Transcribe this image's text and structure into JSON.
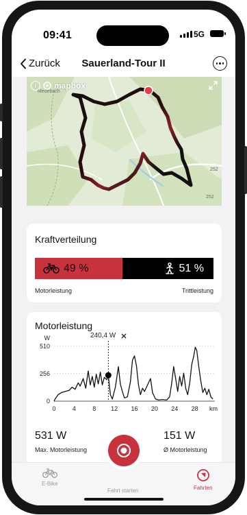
{
  "status": {
    "time": "09:41",
    "network": "5G"
  },
  "nav": {
    "back_label": "Zurück",
    "title": "Sauerland-Tour II"
  },
  "map": {
    "attribution": "mapbox",
    "place_label": "Medebach",
    "road_labels": [
      "252",
      "252"
    ],
    "route_colors": {
      "low": "#111111",
      "high": "#c8323d"
    }
  },
  "force": {
    "title": "Kraftverteilung",
    "motor_percent": "49 %",
    "pedal_percent": "51 %",
    "motor_share": 0.49,
    "motor_label": "Motorleistung",
    "pedal_label": "Trittleistung",
    "motor_color": "#c8323d",
    "pedal_color": "#000000"
  },
  "power_card": {
    "title": "Motorleistung",
    "tooltip": "240,4 W",
    "max_value": "531 W",
    "max_label": "Max. Motorleistung",
    "avg_value": "151 W",
    "avg_label": "Ø Motorleistung"
  },
  "chart_data": {
    "type": "line",
    "ylabel": "W",
    "xlabel": "km",
    "yticks": [
      0,
      256,
      510
    ],
    "xticks": [
      0,
      4,
      8,
      12,
      16,
      20,
      24,
      28
    ],
    "ylim": [
      0,
      560
    ],
    "xlim": [
      0,
      32
    ],
    "grid": true,
    "marker": {
      "x": 10.8,
      "y": 240.4
    },
    "series": [
      {
        "values": [
          [
            0.2,
            20
          ],
          [
            0.8,
            60
          ],
          [
            1.5,
            80
          ],
          [
            2.2,
            90
          ],
          [
            3.0,
            100
          ],
          [
            3.6,
            130
          ],
          [
            4.2,
            110
          ],
          [
            4.8,
            170
          ],
          [
            5.2,
            140
          ],
          [
            5.8,
            210
          ],
          [
            6.3,
            120
          ],
          [
            6.8,
            280
          ],
          [
            7.2,
            150
          ],
          [
            7.6,
            230
          ],
          [
            8.0,
            130
          ],
          [
            8.4,
            250
          ],
          [
            8.8,
            160
          ],
          [
            9.2,
            270
          ],
          [
            9.6,
            150
          ],
          [
            10.0,
            220
          ],
          [
            10.5,
            200
          ],
          [
            10.8,
            240
          ],
          [
            11.2,
            60
          ],
          [
            11.6,
            20
          ],
          [
            12.2,
            130
          ],
          [
            12.8,
            320
          ],
          [
            13.2,
            160
          ],
          [
            13.6,
            90
          ],
          [
            14.0,
            30
          ],
          [
            14.6,
            40
          ],
          [
            15.2,
            180
          ],
          [
            15.6,
            380
          ],
          [
            16.0,
            420
          ],
          [
            16.4,
            330
          ],
          [
            16.8,
            150
          ],
          [
            17.2,
            60
          ],
          [
            17.6,
            120
          ],
          [
            18.0,
            90
          ],
          [
            18.6,
            150
          ],
          [
            19.2,
            210
          ],
          [
            19.6,
            80
          ],
          [
            20.2,
            20
          ],
          [
            20.8,
            10
          ],
          [
            21.6,
            15
          ],
          [
            22.4,
            10
          ],
          [
            23.0,
            40
          ],
          [
            23.4,
            160
          ],
          [
            23.8,
            320
          ],
          [
            24.2,
            210
          ],
          [
            24.6,
            90
          ],
          [
            25.0,
            230
          ],
          [
            25.4,
            140
          ],
          [
            25.8,
            260
          ],
          [
            26.2,
            120
          ],
          [
            26.6,
            60
          ],
          [
            27.0,
            170
          ],
          [
            27.4,
            340
          ],
          [
            27.8,
            420
          ],
          [
            28.1,
            500
          ],
          [
            28.4,
            470
          ],
          [
            28.8,
            320
          ],
          [
            29.2,
            190
          ],
          [
            29.6,
            80
          ],
          [
            30.0,
            120
          ],
          [
            30.4,
            60
          ],
          [
            30.8,
            110
          ],
          [
            31.2,
            40
          ],
          [
            31.6,
            20
          ]
        ]
      }
    ]
  },
  "tabs": [
    {
      "label": "E-Bike",
      "active": false
    },
    {
      "label": "Fahrt starten",
      "active": false
    },
    {
      "label": "Fahrten",
      "active": true
    }
  ]
}
